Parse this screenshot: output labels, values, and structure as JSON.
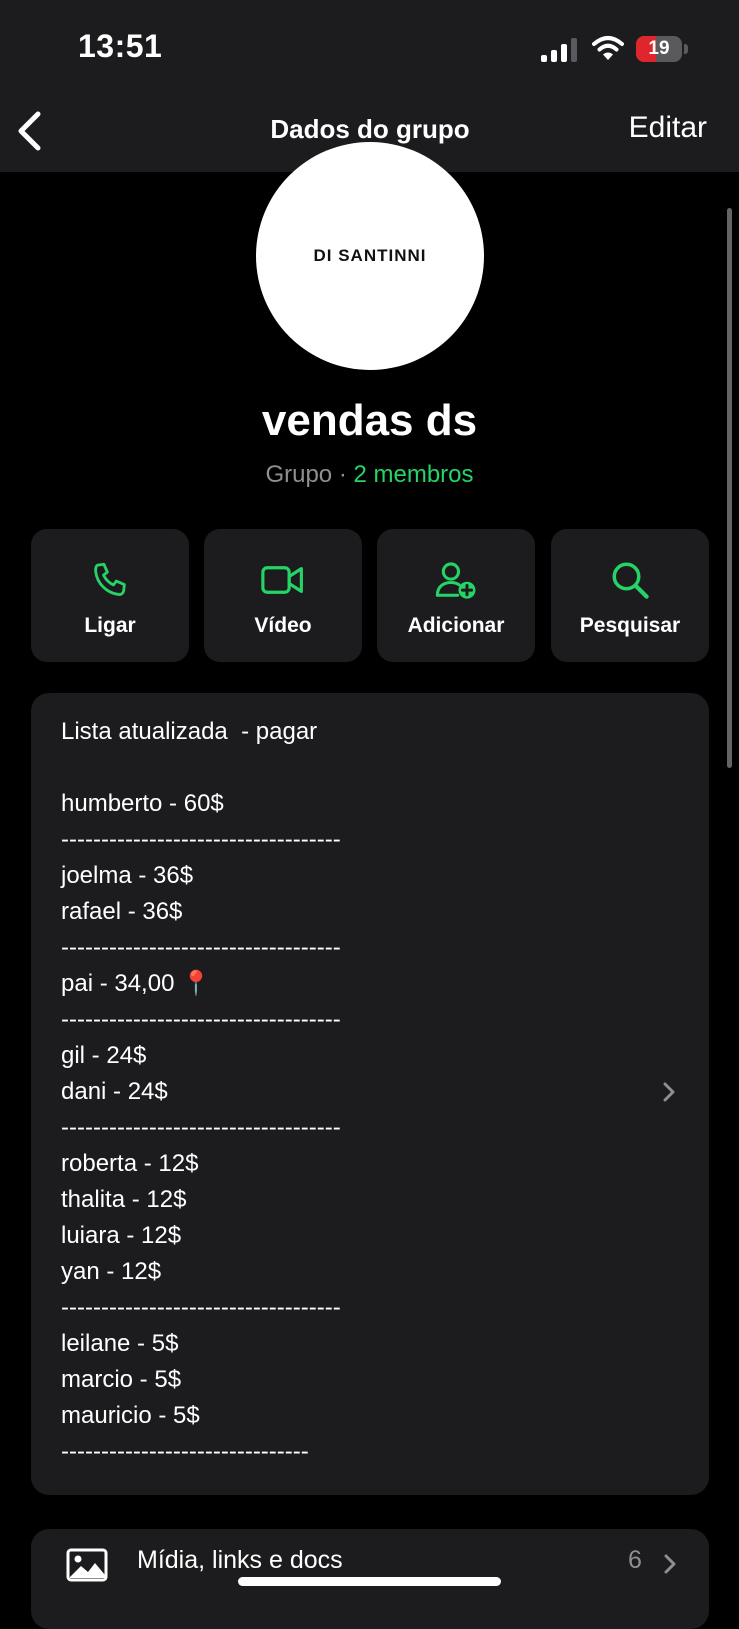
{
  "status_bar": {
    "time": "13:51",
    "battery_level": "19"
  },
  "nav": {
    "back_icon": "chevron-left-icon",
    "title": "Dados do grupo",
    "edit_label": "Editar"
  },
  "profile": {
    "logo_text": "DI SANTINNI",
    "name": "vendas ds",
    "type_label": "Grupo",
    "separator": " · ",
    "members_label": "2 membros",
    "accent_color": "#25d366"
  },
  "actions": [
    {
      "label": "Ligar",
      "icon": "phone-icon"
    },
    {
      "label": "Vídeo",
      "icon": "video-camera-icon"
    },
    {
      "label": "Adicionar",
      "icon": "add-person-icon"
    },
    {
      "label": "Pesquisar",
      "icon": "search-icon"
    }
  ],
  "description": {
    "lines": [
      "Lista atualizada  - pagar",
      "",
      "humberto - 60$",
      "-----------------------------------",
      "joelma - 36$",
      "rafael - 36$",
      "-----------------------------------",
      "pai - 34,00 📍",
      "-----------------------------------",
      "gil - 24$",
      "dani - 24$",
      "-----------------------------------",
      "roberta - 12$",
      "thalita - 12$",
      "luiara - 12$",
      "yan - 12$",
      "-----------------------------------",
      "leilane - 5$",
      "marcio - 5$",
      "mauricio - 5$",
      "-------------------------------"
    ]
  },
  "media_row": {
    "label": "Mídia, links e docs",
    "count": "6",
    "icon": "image-icon"
  }
}
